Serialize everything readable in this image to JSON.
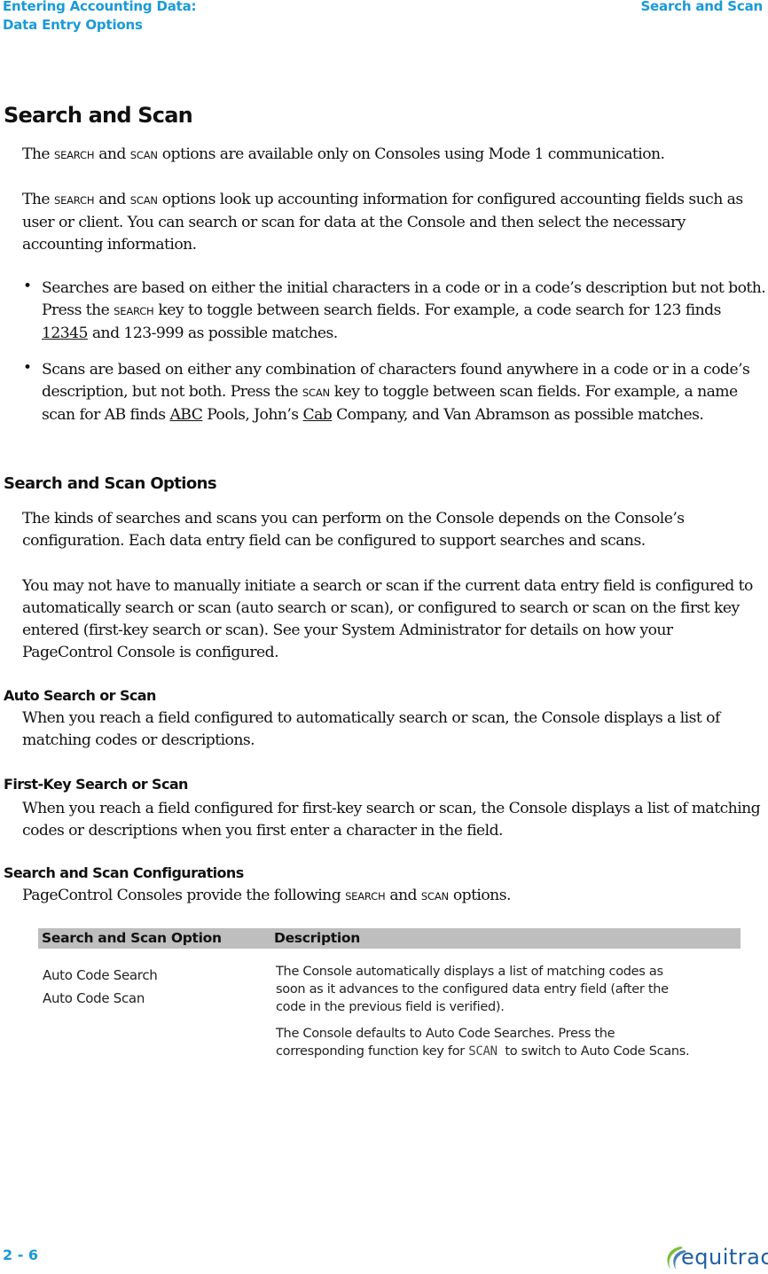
{
  "header": {
    "left_line1": "Entering Accounting Data:",
    "left_line2": "Data Entry Options",
    "right": "Search and Scan"
  },
  "title": "Search and Scan",
  "intro": {
    "p1": {
      "a": "The ",
      "k1": "SEARCH",
      "b": " and ",
      "k2": "SCAN",
      "c": " options are available only on Consoles using Mode 1 communication."
    },
    "p2": {
      "a": "The ",
      "k1": "SEARCH",
      "b": " and ",
      "k2": "SCAN",
      "c": " options look up accounting information for configured accounting fields such as user or client. You can search or scan for data at the Console and then select the necessary accounting information."
    }
  },
  "bullets": [
    {
      "a": "Searches are based on either the initial characters in a code or in a code’s description but not both. Press the ",
      "key": "SEARCH",
      "b": " key to toggle between search fields. For example, a code search for 123 finds ",
      "u1": "12345",
      "c": " and 123-999 as possible matches."
    },
    {
      "a": "Scans are based on either any combination of characters found anywhere in a code or in a code’s description, but not both. Press the ",
      "key": "SCAN",
      "b": " key to toggle between scan fields. For example, a name scan for AB finds ",
      "u1": "ABC",
      "c": " Pools, John’s ",
      "u2": "Cab",
      "d": " Company, and Van Abramson as possible matches."
    }
  ],
  "options_section": {
    "heading": "Search and Scan Options",
    "p1": "The kinds of searches and scans you can perform on the Console depends on the Console’s configuration. Each data entry field can be configured to support searches and scans.",
    "p2": "You may not have to manually initiate a search or scan if the current data entry field is configured to automatically search or scan (auto search or scan), or configured to search or scan on the first key entered (first-key search or scan). See your System Administrator for details on how your PageControl Console is configured."
  },
  "auto": {
    "heading": "Auto Search or Scan",
    "text": "When you reach a field configured to automatically search or scan, the Console displays a list of matching codes or descriptions."
  },
  "firstkey": {
    "heading": "First-Key Search or Scan",
    "text": "When you reach a field configured for first-key search or scan, the Console displays a list of matching codes or descriptions when you first enter a character in the field."
  },
  "configs": {
    "heading": "Search and Scan Configurations",
    "p": {
      "a": "PageControl Consoles provide the following ",
      "k1": "SEARCH",
      "b": " and ",
      "k2": "SCAN",
      "c": " options."
    }
  },
  "table": {
    "headers": [
      "Search and Scan Option",
      "Description"
    ],
    "rows": [
      {
        "options": [
          "Auto Code Search",
          "Auto Code Scan"
        ],
        "desc1": "The Console automatically displays a list of matching codes as soon as it advances to the configured data entry field (after the code in the previous field is verified).",
        "desc2_a": "The Console defaults to Auto Code Searches. Press the corresponding function key for ",
        "desc2_key": "SCAN",
        "desc2_b": "  to switch to Auto Code Scans."
      }
    ]
  },
  "footer": {
    "page_number": "2 - 6",
    "logo_text": "equitrac"
  },
  "colors": {
    "accent": "#1a9ad6",
    "table_header_bg": "#bebebe",
    "logo_blue": "#1f5fa0",
    "logo_green": "#7cbf3a"
  }
}
